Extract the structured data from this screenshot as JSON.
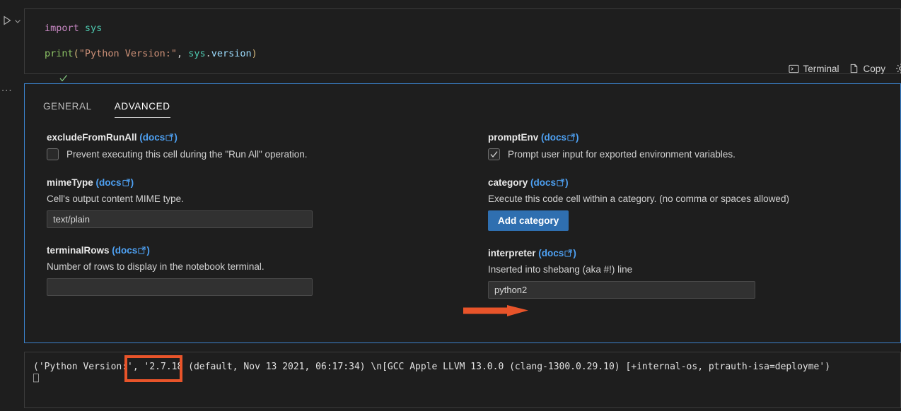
{
  "gutter": {
    "run_icon": "play-icon",
    "collapse_icon": "chevron-down-icon",
    "more_icon": "ellipsis-icon",
    "more_label": "..."
  },
  "code_cell": {
    "status_icon": "check-icon",
    "lines": [
      {
        "tokens": [
          {
            "t": "import",
            "c": "kw"
          },
          {
            "t": " ",
            "c": "plain"
          },
          {
            "t": "sys",
            "c": "mod"
          }
        ]
      },
      {
        "tokens": [
          {
            "t": "print",
            "c": "fn"
          },
          {
            "t": "(",
            "c": "paren"
          },
          {
            "t": "\"Python Version:\"",
            "c": "str"
          },
          {
            "t": ", ",
            "c": "plain"
          },
          {
            "t": "sys",
            "c": "mod"
          },
          {
            "t": ".",
            "c": "plain"
          },
          {
            "t": "version",
            "c": "prop"
          },
          {
            "t": ")",
            "c": "paren"
          }
        ]
      }
    ],
    "line1_plain": "import sys",
    "line2_plain": "print(\"Python Version:\", sys.version)"
  },
  "toolbar": {
    "terminal_label": "Terminal",
    "terminal_icon": "terminal-icon",
    "copy_label": "Copy",
    "copy_icon": "copy-icon",
    "gear_icon": "gear-icon"
  },
  "settings": {
    "tabs": [
      {
        "label": "GENERAL",
        "active": false
      },
      {
        "label": "ADVANCED",
        "active": true
      }
    ],
    "docs_text": "docs",
    "docs_icon": "external-link-icon",
    "left_fields": [
      {
        "name": "excludeFromRunAll",
        "checkbox_label": "Prevent executing this cell during the \"Run All\" operation.",
        "checked": false
      },
      {
        "name": "mimeType",
        "description": "Cell's output content MIME type.",
        "value": "text/plain",
        "placeholder": ""
      },
      {
        "name": "terminalRows",
        "description": "Number of rows to display in the notebook terminal.",
        "value": "",
        "placeholder": ""
      }
    ],
    "right_fields": [
      {
        "name": "promptEnv",
        "checkbox_label": "Prompt user input for exported environment variables.",
        "checked": true
      },
      {
        "name": "category",
        "description": "Execute this code cell within a category. (no comma or spaces allowed)",
        "button_label": "Add category"
      },
      {
        "name": "interpreter",
        "description": "Inserted into shebang (aka #!) line",
        "value": "python2",
        "placeholder": ""
      }
    ]
  },
  "output": {
    "text": "('Python Version:', '2.7.18 (default, Nov 13 2021, 06:17:34) \\n[GCC Apple LLVM 13.0.0 (clang-1300.0.29.10) [+internal-os, ptrauth-isa=deployme')",
    "cursor_glyph": "⎕",
    "highlighted_value": "'2.7.18 ("
  },
  "annotations": {
    "arrow_color": "#e8542a",
    "highlight_color": "#e8542a",
    "arrow_target": "interpreter-input",
    "highlight_target": "output-version"
  },
  "colors": {
    "panel_border": "#3b82cc",
    "accent_blue": "#4ea1f3",
    "button_blue": "#2f6fb0",
    "background": "#1e1e1e",
    "annotation_orange": "#e8542a"
  }
}
